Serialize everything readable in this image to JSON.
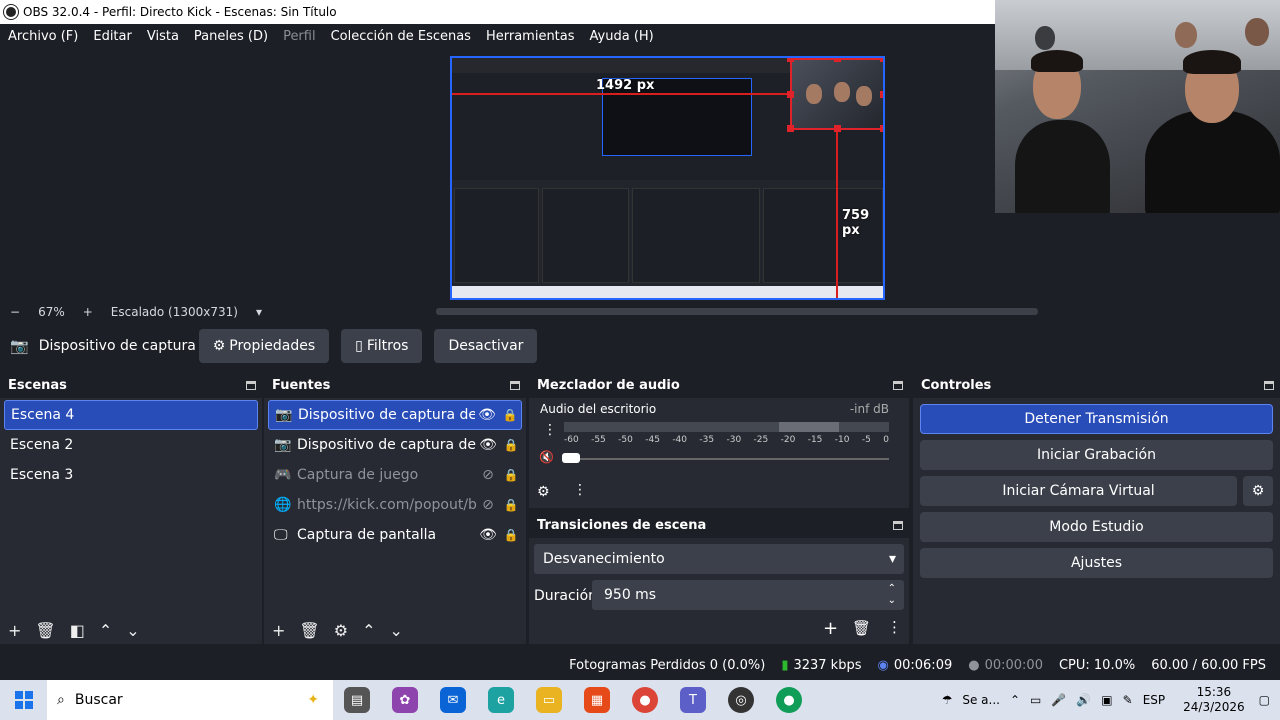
{
  "window": {
    "title": "OBS 32.0.4 - Perfil: Directo Kick - Escenas: Sin Título"
  },
  "menu": [
    "Archivo (F)",
    "Editar",
    "Vista",
    "Paneles (D)",
    "Perfil",
    "Colección de Escenas",
    "Herramientas",
    "Ayuda (H)"
  ],
  "preview": {
    "measure_h": "1492 px",
    "measure_v": "759 px"
  },
  "zoom": {
    "minus": "−",
    "value": "67%",
    "plus": "+",
    "scale": "Escalado (1300x731)",
    "dropdown": "▾"
  },
  "source_toolbar": {
    "source_name": "Dispositivo de captura de v",
    "properties": "Propiedades",
    "filters": "Filtros",
    "deactivate": "Desactivar"
  },
  "scenes": {
    "title": "Escenas",
    "items": [
      "Escena 4",
      "Escena 2",
      "Escena 3"
    ]
  },
  "sources": {
    "title": "Fuentes",
    "items": [
      {
        "label": "Dispositivo de captura de vídeo",
        "icon": "camera-icon",
        "glyph": "📷",
        "visible": true,
        "selected": true
      },
      {
        "label": "Dispositivo de captura de vídeo",
        "icon": "camera-icon",
        "glyph": "📷",
        "visible": true,
        "selected": false
      },
      {
        "label": "Captura de juego",
        "icon": "gamepad-icon",
        "glyph": "🎮",
        "visible": false,
        "selected": false
      },
      {
        "label": "https://kick.com/popout/bal",
        "icon": "globe-icon",
        "glyph": "🌐",
        "visible": false,
        "selected": false
      },
      {
        "label": "Captura de pantalla",
        "icon": "monitor-icon",
        "glyph": "🖵",
        "visible": true,
        "selected": false
      }
    ]
  },
  "mixer": {
    "title": "Mezclador de audio",
    "track": "Audio del escritorio",
    "level": "-inf dB",
    "ticks": [
      "-60",
      "-55",
      "-50",
      "-45",
      "-40",
      "-35",
      "-30",
      "-25",
      "-20",
      "-15",
      "-10",
      "-5",
      "0"
    ]
  },
  "transitions": {
    "title": "Transiciones de escena",
    "selected": "Desvanecimiento",
    "duration_label": "Duración",
    "duration_value": "950 ms"
  },
  "controls": {
    "title": "Controles",
    "stop_stream": "Detener Transmisión",
    "start_recording": "Iniciar Grabación",
    "virtual_cam": "Iniciar Cámara Virtual",
    "studio_mode": "Modo Estudio",
    "settings": "Ajustes"
  },
  "status": {
    "dropped": "Fotogramas Perdidos 0 (0.0%)",
    "bitrate": "3237 kbps",
    "stream_time": "00:06:09",
    "rec_time": "00:00:00",
    "cpu": "CPU: 10.0%",
    "fps": "60.00 / 60.00 FPS"
  },
  "taskbar": {
    "search": "Buscar",
    "weather": "Se a...",
    "language": "ESP",
    "time": "15:36",
    "date": "24/3/2026"
  },
  "colors": {
    "accent": "#284cb8",
    "bg": "#1d1f26",
    "dock": "#272a33",
    "button": "#3c404b",
    "measure": "#d91e1e"
  }
}
